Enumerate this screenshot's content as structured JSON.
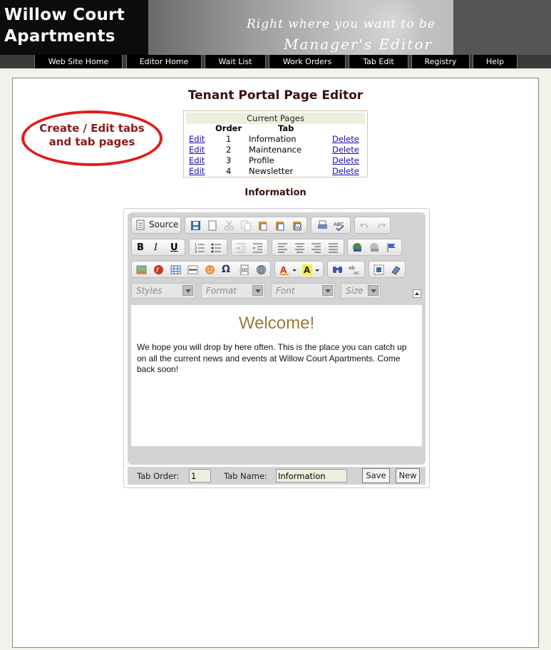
{
  "header": {
    "logo_line1": "Willow Court",
    "logo_line2": "Apartments",
    "tagline": "Right where you want to be",
    "subtagline": "Manager's Editor"
  },
  "nav": [
    "Web Site Home",
    "Editor Home",
    "Wait List",
    "Work Orders",
    "Tab Edit",
    "Registry",
    "Help"
  ],
  "page": {
    "title": "Tenant Portal Page Editor",
    "callout_line1": "Create / Edit tabs",
    "callout_line2": "and tab pages",
    "current_tab_title": "Information"
  },
  "pages_table": {
    "caption": "Current Pages",
    "headers": [
      "Order",
      "Tab"
    ],
    "edit_label": "Edit",
    "delete_label": "Delete",
    "rows": [
      {
        "order": "1",
        "tab": "Information"
      },
      {
        "order": "2",
        "tab": "Maintenance"
      },
      {
        "order": "3",
        "tab": "Profile"
      },
      {
        "order": "4",
        "tab": "Newsletter"
      }
    ]
  },
  "editor": {
    "source_label": "Source",
    "combos": [
      "Styles",
      "Format",
      "Font",
      "Size"
    ],
    "content_heading": "Welcome!",
    "content_text": "We hope you will drop by here often. This is the place you can catch up on all the current news and events at Willow Court Apartments. Come back soon!",
    "heading_color": "#9a7a3a"
  },
  "form": {
    "tab_order_label": "Tab Order:",
    "tab_order_value": "1",
    "tab_name_label": "Tab Name:",
    "tab_name_value": "Information",
    "save_label": "Save",
    "new_label": "New"
  },
  "colors": {
    "callout_border": "#e01d1d",
    "title_color": "#3a0f0f",
    "link_color": "#1a0dab"
  }
}
